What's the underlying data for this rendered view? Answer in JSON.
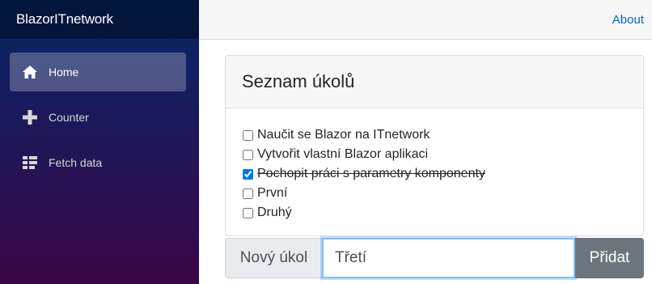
{
  "app": {
    "brand": "BlazorITnetwork"
  },
  "sidebar": {
    "items": [
      {
        "label": "Home",
        "icon": "home-icon",
        "active": true
      },
      {
        "label": "Counter",
        "icon": "plus-icon",
        "active": false
      },
      {
        "label": "Fetch data",
        "icon": "list-rich-icon",
        "active": false
      }
    ]
  },
  "topbar": {
    "about_label": "About"
  },
  "todo": {
    "title": "Seznam úkolů",
    "tasks": [
      {
        "text": "Naučit se Blazor na ITnetwork",
        "done": false
      },
      {
        "text": "Vytvořit vlastní Blazor aplikaci",
        "done": false
      },
      {
        "text": "Pochopit práci s parametry komponenty",
        "done": true
      },
      {
        "text": "První",
        "done": false
      },
      {
        "text": "Druhý",
        "done": false
      }
    ],
    "new_task_label": "Nový úkol",
    "new_task_value": "Třetí",
    "add_button_label": "Přidat"
  },
  "colors": {
    "sidebar_top": "#052767",
    "sidebar_bottom": "#3a0647",
    "link": "#0366d6",
    "button": "#6c757d"
  }
}
